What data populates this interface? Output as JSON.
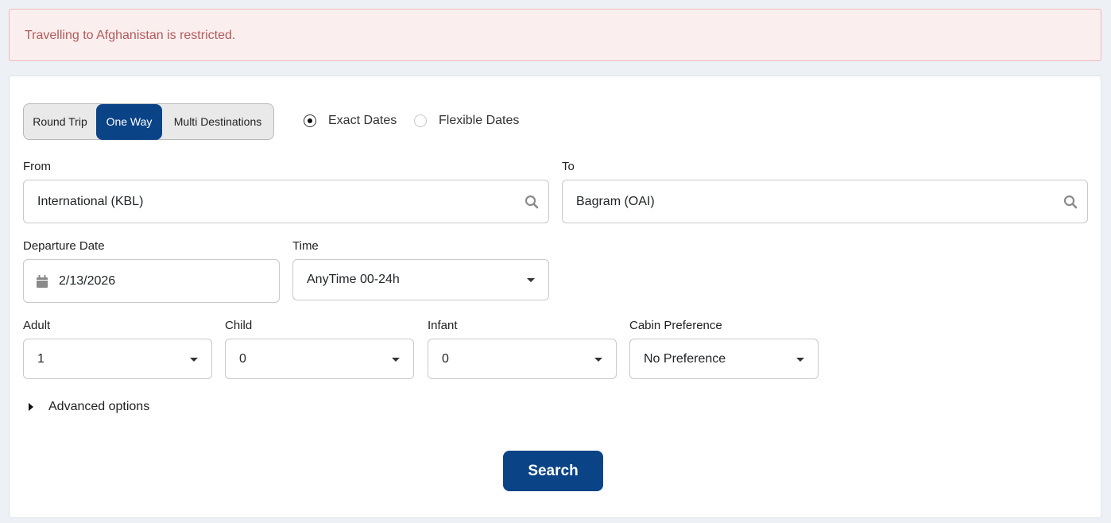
{
  "alert": {
    "message": "Travelling to Afghanistan is restricted."
  },
  "trip_type": {
    "options": [
      "Round Trip",
      "One Way",
      "Multi Destinations"
    ],
    "selected": "One Way"
  },
  "date_mode": {
    "exact_label": "Exact Dates",
    "flexible_label": "Flexible Dates",
    "selected": "Exact Dates"
  },
  "from": {
    "label": "From",
    "value": "International (KBL)"
  },
  "to": {
    "label": "To",
    "value": "Bagram (OAI)"
  },
  "departure": {
    "label": "Departure Date",
    "value": "2/13/2026"
  },
  "time": {
    "label": "Time",
    "value": "AnyTime 00-24h"
  },
  "adult": {
    "label": "Adult",
    "value": "1"
  },
  "child": {
    "label": "Child",
    "value": "0"
  },
  "infant": {
    "label": "Infant",
    "value": "0"
  },
  "cabin": {
    "label": "Cabin Preference",
    "value": "No Preference"
  },
  "advanced": {
    "label": "Advanced options"
  },
  "search": {
    "label": "Search"
  },
  "colors": {
    "primary": "#0b4486",
    "alert_bg": "#fbeeee",
    "alert_text": "#b35a5a"
  }
}
